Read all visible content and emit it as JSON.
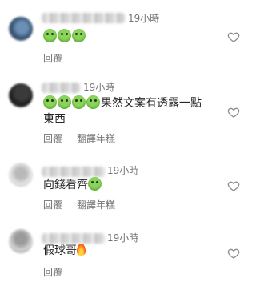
{
  "comments": [
    {
      "time": "19小時",
      "text": "",
      "emoji_count": 3,
      "actions": [
        "回覆"
      ]
    },
    {
      "time": "19小時",
      "text_line1": "果然文案有透露一點",
      "text_line2": "東西",
      "emoji_count": 4,
      "actions": [
        "回覆",
        "翻譯年糕"
      ]
    },
    {
      "time": "19小時",
      "text": "向錢看齊",
      "emoji_count": 1,
      "actions": [
        "回覆",
        "翻譯年糕"
      ]
    },
    {
      "time": "19小時",
      "text": "假球哥",
      "emoji_count": 0,
      "actions": [
        "回覆"
      ]
    }
  ],
  "icons": {
    "emoji": "green-face-emoji",
    "fire": "fire-emoji",
    "like": "heart-icon"
  },
  "colors": {
    "text": "#262626",
    "secondary": "#737373"
  }
}
